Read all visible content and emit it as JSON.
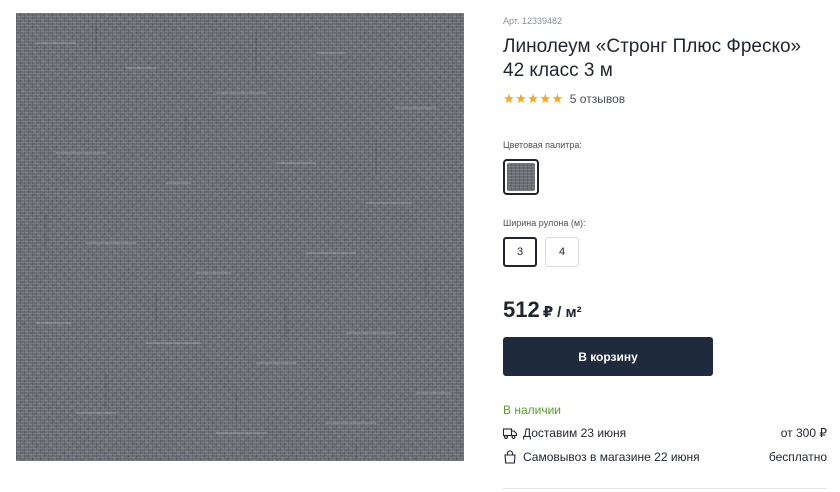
{
  "product": {
    "sku": "Арт. 12339482",
    "title_line1": "Линолеум «Стронг Плюс Фреско»",
    "title_line2": "42 класс 3 м",
    "rating": 5,
    "stars": "★★★★★",
    "reviews": "5 отзывов",
    "image_icon": "linoleum-texture-photo"
  },
  "options": {
    "palette_label": "Цветовая палитра:",
    "swatch_color": "#6b6e74",
    "width_label": "Ширина рулона (м):",
    "widths": [
      "3",
      "4"
    ],
    "selected_width": "3"
  },
  "price": {
    "value": "512",
    "currency": "₽",
    "unit": "/ м²"
  },
  "cart": {
    "button_label": "В корзину"
  },
  "stock": {
    "status": "В наличии",
    "status_color": "#5aa02c"
  },
  "delivery": [
    {
      "icon": "truck-icon",
      "label": "Доставим 23 июня",
      "cost": "от 300 ₽"
    },
    {
      "icon": "bag-icon",
      "label": "Самовывоз в магазине 22 июня",
      "cost": "бесплатно"
    }
  ],
  "colors": {
    "button_bg": "#1f2a3c",
    "star": "#f5a623"
  }
}
